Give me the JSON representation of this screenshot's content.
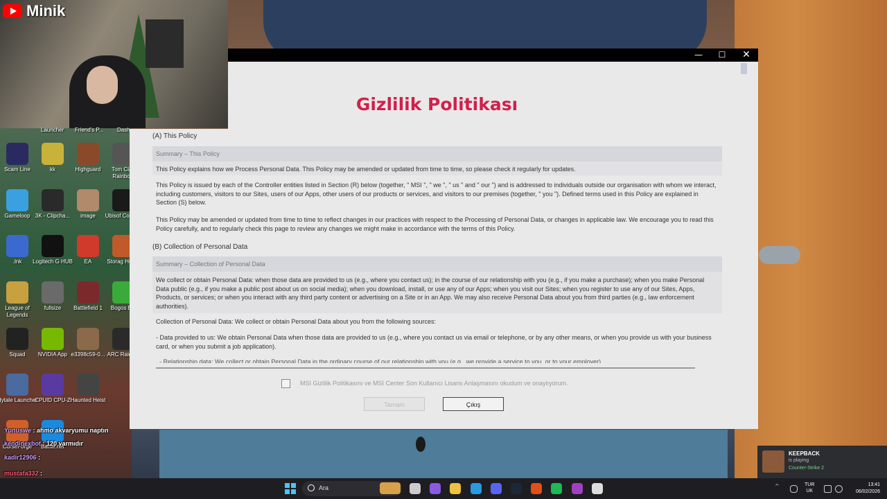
{
  "stream": {
    "channel_name": "Minik"
  },
  "desktop": {
    "partial_labels": [
      "Launcher",
      "Friend's P...",
      "Dash"
    ],
    "icons": [
      {
        "label": "Scam Line",
        "color": "#2a2a60"
      },
      {
        "label": "kk",
        "color": "#c8b23a"
      },
      {
        "label": "Highguard",
        "color": "#8a4a2a"
      },
      {
        "label": "Tom Clan Rainbow",
        "color": "#555555"
      },
      {
        "label": "Gameloop",
        "color": "#3aa0e0"
      },
      {
        "label": "3K - Clipcha...",
        "color": "#2a2a2a"
      },
      {
        "label": "image",
        "color": "#b08a6a"
      },
      {
        "label": "Ubisof Connec",
        "color": "#1a1a1a"
      },
      {
        "label": ".lnk",
        "color": "#3a6ad0"
      },
      {
        "label": "Logitech G HUB",
        "color": "#111111"
      },
      {
        "label": "EA",
        "color": "#d03a2a"
      },
      {
        "label": "Storag Hunte",
        "color": "#c05a2a"
      },
      {
        "label": "League of Legends",
        "color": "#c8a040"
      },
      {
        "label": "fullsize",
        "color": "#6a6a6a"
      },
      {
        "label": "Battlefield 1",
        "color": "#7a2a2a"
      },
      {
        "label": "Bogos Bin",
        "color": "#3aaa3a"
      },
      {
        "label": "Squad",
        "color": "#222222"
      },
      {
        "label": "NVIDIA App",
        "color": "#76b900"
      },
      {
        "label": "e3398c59-0...",
        "color": "#8a6a4a"
      },
      {
        "label": "ARC Raiders",
        "color": "#2a2a2a"
      },
      {
        "label": "Hytale Launcher",
        "color": "#4a6aa0"
      },
      {
        "label": "CPUID CPU-Z",
        "color": "#5a3aa0"
      },
      {
        "label": "Haunted Heist",
        "color": "#444444"
      },
      {
        "label": "CurseForge",
        "color": "#d0602a"
      },
      {
        "label": "Battle.net",
        "color": "#1a8ae0"
      }
    ]
  },
  "chat": [
    {
      "user": "Yunuswe",
      "message": ": ahmo akvaryumu naptın",
      "red": false
    },
    {
      "user": "kendinexbot",
      "message": ": 120 varmıdır",
      "red": false
    },
    {
      "user": "kadir12906",
      "message": ":",
      "red": false
    },
    {
      "user": "mustafa332",
      "message": ":",
      "red": true
    },
    {
      "user": "Yunuswe",
      "message": ":",
      "red": false
    }
  ],
  "window": {
    "controls": {
      "minimize": "—",
      "maximize": "☐",
      "close": "✕"
    },
    "title": "Gizlilik Politikası",
    "sections": [
      {
        "heading": "(A) This Policy",
        "summary": "Summary – This Policy",
        "paragraphs": [
          "This Policy explains how we Process Personal Data. This Policy may be amended or updated from time to time, so please check it regularly for updates.",
          "This Policy is issued by each of the Controller entities listed in Section (R) below (together, \" MSI \", \" we \", \" us \" and \" our \") and is addressed to individuals outside our organisation with whom we interact, including customers, visitors to our Sites, users of our Apps, other users of our products or services, and visitors to our premises (together, \" you \"). Defined terms used in this Policy are explained in Section (S) below.",
          "This Policy may be amended or updated from time to time to reflect changes in our practices with respect to the Processing of Personal Data, or changes in applicable law. We encourage you to read this Policy carefully, and to regularly check this page to review any changes we might make in accordance with the terms of this Policy."
        ]
      },
      {
        "heading": "(B) Collection of Personal Data",
        "summary": "Summary – Collection of Personal Data",
        "paragraphs": [
          "We collect or obtain Personal Data: when those data are provided to us (e.g., where you contact us); in the course of our relationship with you (e.g., if you make a purchase); when you make Personal Data public (e.g., if you make a public post about us on social media); when you download, install, or use any of our Apps; when you visit our Sites; when you register to use any of our Sites, Apps, Products, or services; or when you interact with any third party content or advertising on a Site or in an App. We may also receive Personal Data about you from third parties (e.g., law enforcement authorities).",
          "Collection of Personal Data: We collect or obtain Personal Data about you from the following sources:",
          "- Data provided to us: We obtain Personal Data when those data are provided to us (e.g., where you contact us via email or telephone, or by any other means, or when you provide us with your business card, or when you submit a job application).",
          "- Relationship data: We collect or obtain Personal Data in the ordinary course of our relationship with you (e.g., we provide a service to you, or to your employer)."
        ]
      }
    ],
    "agree_text": "MSI Gizlilik Politikasını ve MSI Center Son Kullanıcı Lisans Anlaşmasını okudum ve onaylıyorum.",
    "ok_button": "Tamam",
    "exit_button": "Çıkış"
  },
  "notification": {
    "name": "KEEPBACK",
    "status": "is playing",
    "game": "Counter-Strike 2"
  },
  "taskbar": {
    "search_placeholder": "Ara",
    "apps": [
      {
        "name": "task-view",
        "color": "#cccccc"
      },
      {
        "name": "copilot",
        "color": "#8a5ae0"
      },
      {
        "name": "file-explorer",
        "color": "#f0c040"
      },
      {
        "name": "edge",
        "color": "#2a9ae0"
      },
      {
        "name": "discord",
        "color": "#5865f2"
      },
      {
        "name": "steam",
        "color": "#1b2838"
      },
      {
        "name": "brave",
        "color": "#e0501a"
      },
      {
        "name": "spotify",
        "color": "#1db954"
      },
      {
        "name": "app-purple",
        "color": "#a040c0"
      },
      {
        "name": "chrome",
        "color": "#dddddd"
      }
    ],
    "lang_top": "TUR",
    "lang_bottom": "UK",
    "time": "13:41",
    "date": "06/02/2026"
  }
}
